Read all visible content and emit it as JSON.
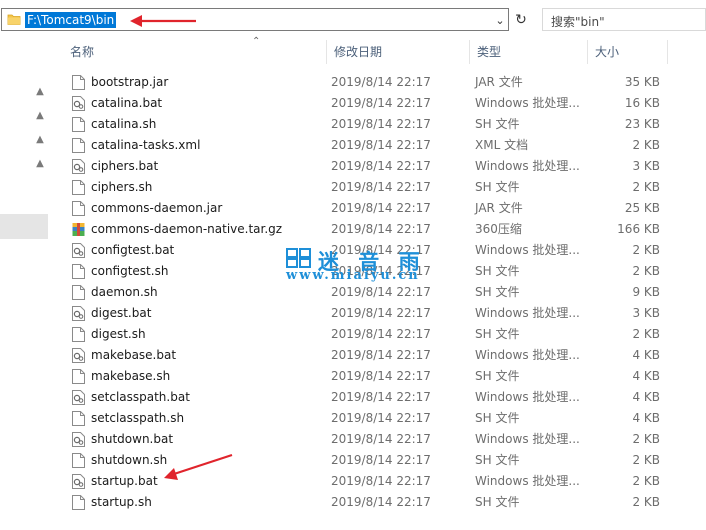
{
  "address_bar": {
    "path": "F:\\Tomcat9\\bin"
  },
  "search": {
    "placeholder": "搜索\"bin\""
  },
  "columns": {
    "name": "名称",
    "date": "修改日期",
    "type": "类型",
    "size": "大小"
  },
  "files": [
    {
      "name": "bootstrap.jar",
      "date": "2019/8/14 22:17",
      "type": "JAR 文件",
      "size": "35 KB",
      "icon": "jar-file-icon"
    },
    {
      "name": "catalina.bat",
      "date": "2019/8/14 22:17",
      "type": "Windows 批处理...",
      "size": "16 KB",
      "icon": "bat-file-icon"
    },
    {
      "name": "catalina.sh",
      "date": "2019/8/14 22:17",
      "type": "SH 文件",
      "size": "23 KB",
      "icon": "generic-file-icon"
    },
    {
      "name": "catalina-tasks.xml",
      "date": "2019/8/14 22:17",
      "type": "XML 文档",
      "size": "2 KB",
      "icon": "generic-file-icon"
    },
    {
      "name": "ciphers.bat",
      "date": "2019/8/14 22:17",
      "type": "Windows 批处理...",
      "size": "3 KB",
      "icon": "bat-file-icon"
    },
    {
      "name": "ciphers.sh",
      "date": "2019/8/14 22:17",
      "type": "SH 文件",
      "size": "2 KB",
      "icon": "generic-file-icon"
    },
    {
      "name": "commons-daemon.jar",
      "date": "2019/8/14 22:17",
      "type": "JAR 文件",
      "size": "25 KB",
      "icon": "jar-file-icon"
    },
    {
      "name": "commons-daemon-native.tar.gz",
      "date": "2019/8/14 22:17",
      "type": "360压缩",
      "size": "166 KB",
      "icon": "archive-file-icon"
    },
    {
      "name": "configtest.bat",
      "date": "2019/8/14 22:17",
      "type": "Windows 批处理...",
      "size": "2 KB",
      "icon": "bat-file-icon"
    },
    {
      "name": "configtest.sh",
      "date": "2019/8/14 22:17",
      "type": "SH 文件",
      "size": "2 KB",
      "icon": "generic-file-icon"
    },
    {
      "name": "daemon.sh",
      "date": "2019/8/14 22:17",
      "type": "SH 文件",
      "size": "9 KB",
      "icon": "generic-file-icon"
    },
    {
      "name": "digest.bat",
      "date": "2019/8/14 22:17",
      "type": "Windows 批处理...",
      "size": "3 KB",
      "icon": "bat-file-icon"
    },
    {
      "name": "digest.sh",
      "date": "2019/8/14 22:17",
      "type": "SH 文件",
      "size": "2 KB",
      "icon": "generic-file-icon"
    },
    {
      "name": "makebase.bat",
      "date": "2019/8/14 22:17",
      "type": "Windows 批处理...",
      "size": "4 KB",
      "icon": "bat-file-icon"
    },
    {
      "name": "makebase.sh",
      "date": "2019/8/14 22:17",
      "type": "SH 文件",
      "size": "4 KB",
      "icon": "generic-file-icon"
    },
    {
      "name": "setclasspath.bat",
      "date": "2019/8/14 22:17",
      "type": "Windows 批处理...",
      "size": "4 KB",
      "icon": "bat-file-icon"
    },
    {
      "name": "setclasspath.sh",
      "date": "2019/8/14 22:17",
      "type": "SH 文件",
      "size": "4 KB",
      "icon": "generic-file-icon"
    },
    {
      "name": "shutdown.bat",
      "date": "2019/8/14 22:17",
      "type": "Windows 批处理...",
      "size": "2 KB",
      "icon": "bat-file-icon"
    },
    {
      "name": "shutdown.sh",
      "date": "2019/8/14 22:17",
      "type": "SH 文件",
      "size": "2 KB",
      "icon": "generic-file-icon"
    },
    {
      "name": "startup.bat",
      "date": "2019/8/14 22:17",
      "type": "Windows 批处理...",
      "size": "2 KB",
      "icon": "bat-file-icon"
    },
    {
      "name": "startup.sh",
      "date": "2019/8/14 22:17",
      "type": "SH 文件",
      "size": "2 KB",
      "icon": "generic-file-icon"
    }
  ],
  "watermark": {
    "title": "迷 音 雨",
    "url": "www.miaiyu.cn"
  },
  "colors": {
    "selection": "#0078d7",
    "annotation_arrow": "#e0242c",
    "watermark": "#1e8fd8",
    "folder": "#f4c54a"
  }
}
